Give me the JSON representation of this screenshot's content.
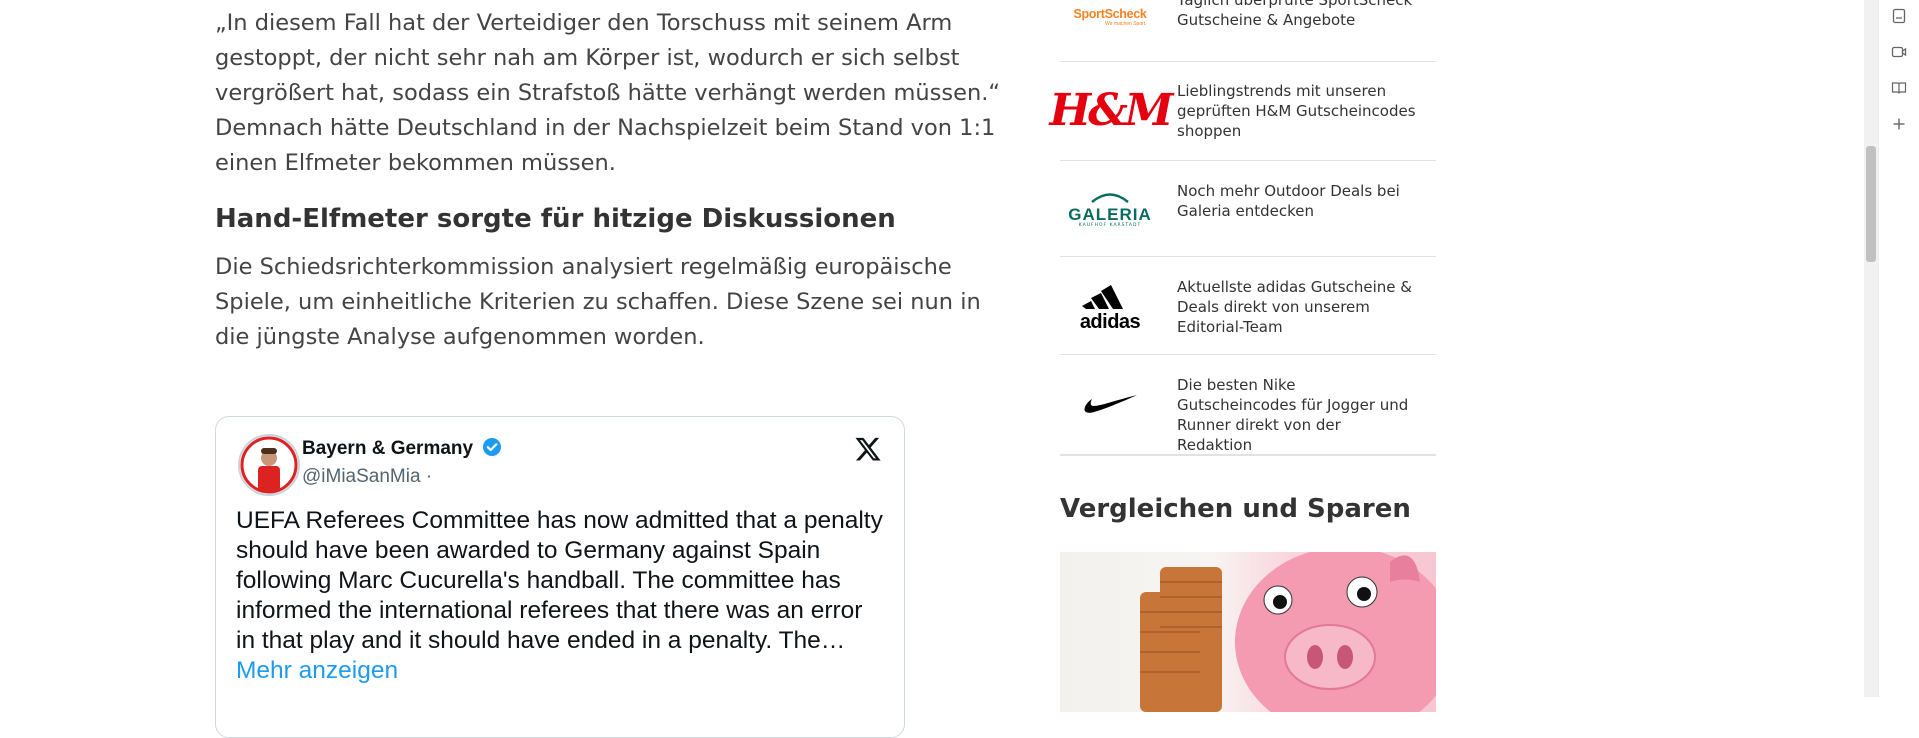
{
  "article": {
    "paragraph1": "„In diesem Fall hat der Verteidiger den Torschuss mit seinem Arm gestoppt, der nicht sehr nah am Körper ist, wodurch er sich selbst vergrößert hat, sodass ein Strafstoß hätte verhängt werden müssen.“ Demnach hätte Deutschland in der Nachspielzeit beim Stand von 1:1 einen Elfmeter bekommen müssen.",
    "heading": "Hand-Elfmeter sorgte für hitzige Diskussionen",
    "paragraph2": "Die Schiedsrichterkommission analysiert regelmäßig europäische Spiele, um einheitliche Kriterien zu schaffen. Diese Szene sei nun in die jüngste Analyse aufgenommen worden."
  },
  "tweet": {
    "author_name": "Bayern & Germany",
    "handle": "@iMiaSanMia ·",
    "text": "UEFA Referees Committee has now admitted that a penalty should have been awarded to Germany against Spain following Marc Cucurella's handball. The committee has informed the international referees that there was an error in that play and it should have ended in a penalty. The…",
    "more_label": "Mehr anzeigen",
    "verified_color": "#1d9bf0"
  },
  "sidebar": {
    "deals": [
      {
        "brand": "SportScheck",
        "brand_sub": "Wir machen Sport.",
        "description": "Täglich überprüfte SportScheck Gutscheine & Angebote",
        "icon": "sportscheck-logo"
      },
      {
        "brand": "H&M",
        "description": "Lieblingstrends mit unseren geprüften H&M Gutscheincodes shoppen",
        "icon": "hm-logo"
      },
      {
        "brand": "GALERIA",
        "brand_sub": "KAUFHOF KARSTADT",
        "description": "Noch mehr Outdoor Deals bei Galeria entdecken",
        "icon": "galeria-logo"
      },
      {
        "brand": "adidas",
        "description": "Aktuellste adidas Gutscheine & Deals direkt von unserem Editorial-Team",
        "icon": "adidas-logo"
      },
      {
        "brand": "Nike",
        "description": "Die besten Nike Gutscheincodes für Jogger und Runner direkt von der Redaktion",
        "icon": "nike-logo"
      }
    ],
    "section_title": "Vergleichen und Sparen",
    "promo_icon": "piggy-bank-coins-image"
  },
  "colors": {
    "hm_red": "#e50010",
    "galeria_green": "#0a6b5f",
    "sportscheck_orange": "#f58220",
    "link_blue": "#1d9bf0"
  },
  "rail_icons": [
    "bookmark-icon",
    "video-icon",
    "reading-list-icon",
    "add-icon"
  ]
}
